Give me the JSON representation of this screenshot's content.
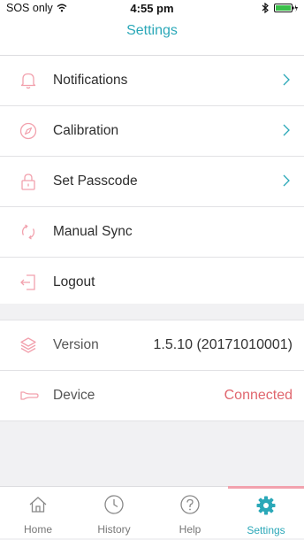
{
  "status_bar": {
    "carrier": "SOS only",
    "time": "4:55 pm"
  },
  "header": {
    "title": "Settings"
  },
  "menu": [
    {
      "label": "Notifications",
      "icon": "bell-icon"
    },
    {
      "label": "Calibration",
      "icon": "compass-icon"
    },
    {
      "label": "Set Passcode",
      "icon": "lock-icon"
    },
    {
      "label": "Manual Sync",
      "icon": "sync-icon"
    },
    {
      "label": "Logout",
      "icon": "logout-icon"
    }
  ],
  "info": {
    "version_label": "Version",
    "version_value": "1.5.10 (20171010001)",
    "device_label": "Device",
    "device_status": "Connected"
  },
  "tabs": [
    {
      "label": "Home",
      "icon": "home-icon"
    },
    {
      "label": "History",
      "icon": "clock-icon"
    },
    {
      "label": "Help",
      "icon": "help-icon"
    },
    {
      "label": "Settings",
      "icon": "gear-icon",
      "active": true
    }
  ],
  "colors": {
    "accent": "#2ba8b8",
    "icon_pink": "#f2a1ad",
    "connected": "#e0666e"
  }
}
